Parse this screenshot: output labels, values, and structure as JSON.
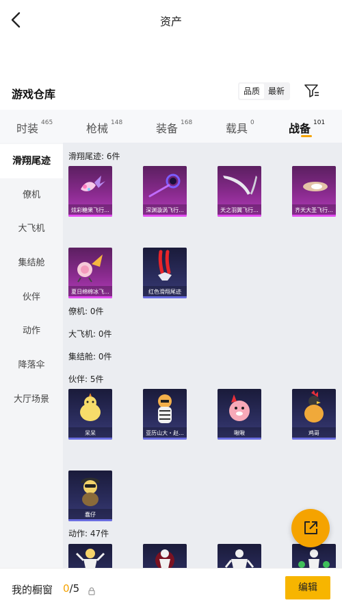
{
  "header": {
    "title": "资产"
  },
  "warehouse": {
    "title": "游戏仓库",
    "sort": [
      {
        "label": "品质",
        "active": true
      },
      {
        "label": "最新",
        "active": false
      }
    ]
  },
  "tabs": [
    {
      "label": "时装",
      "count": "465"
    },
    {
      "label": "枪械",
      "count": "148"
    },
    {
      "label": "装备",
      "count": "168"
    },
    {
      "label": "载具",
      "count": "0"
    },
    {
      "label": "战备",
      "count": "101",
      "active": true
    }
  ],
  "sidebar": [
    "滑翔尾迹",
    "僚机",
    "大飞机",
    "集结舱",
    "伙伴",
    "动作",
    "降落伞",
    "大厅场景"
  ],
  "groups": {
    "glide": {
      "label": "滑翔尾迹: 6件",
      "items": [
        {
          "name": "炫彩糖果飞行...",
          "rarity": "purple",
          "icon": "candy-trail-icon"
        },
        {
          "name": "深渊漩涡飞行...",
          "rarity": "purple",
          "icon": "abyss-vortex-icon"
        },
        {
          "name": "天之羽翼飞行...",
          "rarity": "purple",
          "icon": "sky-wing-icon"
        },
        {
          "name": "齐天大圣飞行...",
          "rarity": "purple",
          "icon": "monkey-king-cloud-icon"
        },
        {
          "name": "夏日绵绵冰飞...",
          "rarity": "purple",
          "icon": "summer-icecream-icon"
        },
        {
          "name": "红色滑翔尾迹",
          "rarity": "blue",
          "icon": "red-trail-icon"
        }
      ]
    },
    "wingman": {
      "label": "僚机: 0件"
    },
    "plane": {
      "label": "大飞机: 0件"
    },
    "capsule": {
      "label": "集结舱: 0件"
    },
    "partner": {
      "label": "伙伴: 5件",
      "items": [
        {
          "name": "呆呆",
          "rarity": "blue",
          "icon": "chick-icon"
        },
        {
          "name": "亚历山大・赵...",
          "rarity": "blue",
          "icon": "tiger-icon"
        },
        {
          "name": "啾啾",
          "rarity": "blue",
          "icon": "pink-bird-icon"
        },
        {
          "name": "鸡哥",
          "rarity": "blue",
          "icon": "rooster-icon"
        },
        {
          "name": "蠢仔",
          "rarity": "blue",
          "icon": "soldier-duck-icon"
        }
      ]
    },
    "emote": {
      "label": "动作: 47件",
      "items": [
        {
          "name": "",
          "rarity": "blue",
          "icon": "emote-pose-icon"
        },
        {
          "name": "",
          "rarity": "blue",
          "icon": "emote-dance-icon"
        },
        {
          "name": "",
          "rarity": "blue",
          "icon": "emote-stretch-icon"
        },
        {
          "name": "",
          "rarity": "blue",
          "icon": "emote-cheer-icon"
        }
      ]
    }
  },
  "showcase": {
    "label": "我的橱窗",
    "current": "0",
    "total": "/5",
    "edit": "编辑"
  },
  "colors": {
    "accent": "#f5a300",
    "purple": "#8a2b8f",
    "blue": "#2b2d5e"
  }
}
